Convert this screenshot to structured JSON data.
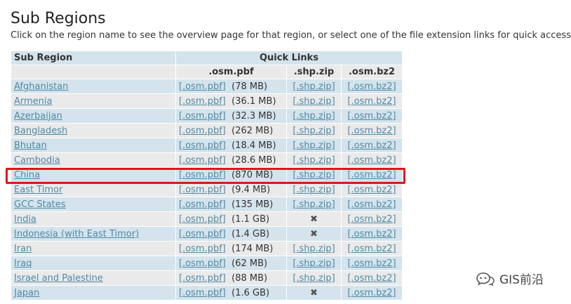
{
  "page": {
    "title": "Sub Regions",
    "subtitle": "Click on the region name to see the overview page for that region, or select one of the file extension links for quick access."
  },
  "table": {
    "header": {
      "sub_region": "Sub Region",
      "quick_links": "Quick Links"
    },
    "subheader": {
      "pbf": ".osm.pbf",
      "shp": ".shp.zip",
      "bz2": ".osm.bz2"
    },
    "rows": [
      {
        "name": "Afghanistan",
        "pbf_link": "[.osm.pbf]",
        "size": "(78 MB)",
        "shp": "[.shp.zip]",
        "bz2": "[.osm.bz2]"
      },
      {
        "name": "Armenia",
        "pbf_link": "[.osm.pbf]",
        "size": "(36.1 MB)",
        "shp": "[.shp.zip]",
        "bz2": "[.osm.bz2]"
      },
      {
        "name": "Azerbaijan",
        "pbf_link": "[.osm.pbf]",
        "size": "(32.3 MB)",
        "shp": "[.shp.zip]",
        "bz2": "[.osm.bz2]"
      },
      {
        "name": "Bangladesh",
        "pbf_link": "[.osm.pbf]",
        "size": "(262 MB)",
        "shp": "[.shp.zip]",
        "bz2": "[.osm.bz2]"
      },
      {
        "name": "Bhutan",
        "pbf_link": "[.osm.pbf]",
        "size": "(18.4 MB)",
        "shp": "[.shp.zip]",
        "bz2": "[.osm.bz2]"
      },
      {
        "name": "Cambodia",
        "pbf_link": "[.osm.pbf]",
        "size": "(28.6 MB)",
        "shp": "[.shp.zip]",
        "bz2": "[.osm.bz2]"
      },
      {
        "name": "China",
        "pbf_link": "[.osm.pbf]",
        "size": "(870 MB)",
        "shp": "[.shp.zip]",
        "bz2": "[.osm.bz2]"
      },
      {
        "name": "East Timor",
        "pbf_link": "[.osm.pbf]",
        "size": "(9.4 MB)",
        "shp": "[.shp.zip]",
        "bz2": "[.osm.bz2]"
      },
      {
        "name": "GCC States",
        "pbf_link": "[.osm.pbf]",
        "size": "(135 MB)",
        "shp": "[.shp.zip]",
        "bz2": "[.osm.bz2]"
      },
      {
        "name": "India",
        "pbf_link": "[.osm.pbf]",
        "size": "(1.1 GB)",
        "shp": "✖",
        "bz2": "[.osm.bz2]"
      },
      {
        "name": "Indonesia (with East Timor)",
        "pbf_link": "[.osm.pbf]",
        "size": "(1.4 GB)",
        "shp": "✖",
        "bz2": "[.osm.bz2]"
      },
      {
        "name": "Iran",
        "pbf_link": "[.osm.pbf]",
        "size": "(174 MB)",
        "shp": "[.shp.zip]",
        "bz2": "[.osm.bz2]"
      },
      {
        "name": "Iraq",
        "pbf_link": "[.osm.pbf]",
        "size": "(62 MB)",
        "shp": "[.shp.zip]",
        "bz2": "[.osm.bz2]"
      },
      {
        "name": "Israel and Palestine",
        "pbf_link": "[.osm.pbf]",
        "size": "(88 MB)",
        "shp": "[.shp.zip]",
        "bz2": "[.osm.bz2]"
      },
      {
        "name": "Japan",
        "pbf_link": "[.osm.pbf]",
        "size": "(1.6 GB)",
        "shp": "✖",
        "bz2": "[.osm.bz2]"
      }
    ]
  },
  "highlighted_row": "China",
  "watermark": {
    "text": "GIS前沿",
    "icon": "wechat-official-account-icon"
  },
  "colors": {
    "link": "#4e8aa6",
    "row_blue": "#d4e3ec",
    "row_gray": "#eaeaea",
    "highlight_border": "#e0161b"
  }
}
